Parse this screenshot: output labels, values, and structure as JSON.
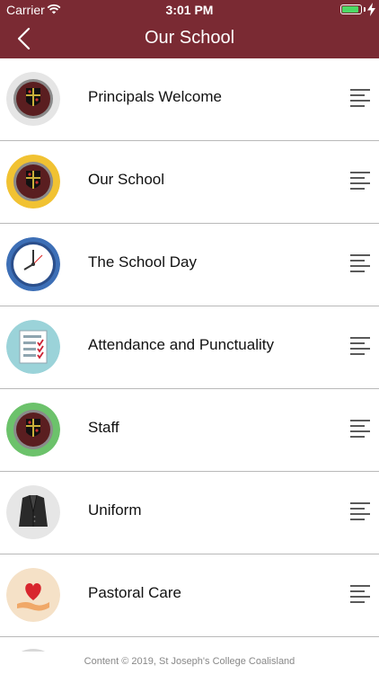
{
  "status_bar": {
    "carrier": "Carrier",
    "time": "3:01 PM",
    "battery_level": 0.95
  },
  "nav": {
    "title": "Our School",
    "back_icon": "chevron-left-icon"
  },
  "menu_items": [
    {
      "label": "Principals Welcome",
      "icon": "school-crest-icon",
      "ring_color": "#e5e5e5"
    },
    {
      "label": "Our School",
      "icon": "school-crest-icon",
      "ring_color": "#f1c232"
    },
    {
      "label": "The School Day",
      "icon": "clock-icon",
      "ring_color": "#3d6fb6"
    },
    {
      "label": "Attendance and Punctuality",
      "icon": "checklist-icon",
      "ring_color": "#9bd3d9"
    },
    {
      "label": "Staff",
      "icon": "school-crest-icon",
      "ring_color": "#6cc26b"
    },
    {
      "label": "Uniform",
      "icon": "blazer-icon",
      "ring_color": "#e6e6e6"
    },
    {
      "label": "Pastoral Care",
      "icon": "heart-hand-icon",
      "ring_color": "#f5e1c7"
    }
  ],
  "footer": {
    "text": "Content © 2019, St Joseph's College Coalisland"
  },
  "colors": {
    "brand": "#7a2a33",
    "divider": "#b9b9b9",
    "text": "#111111"
  }
}
